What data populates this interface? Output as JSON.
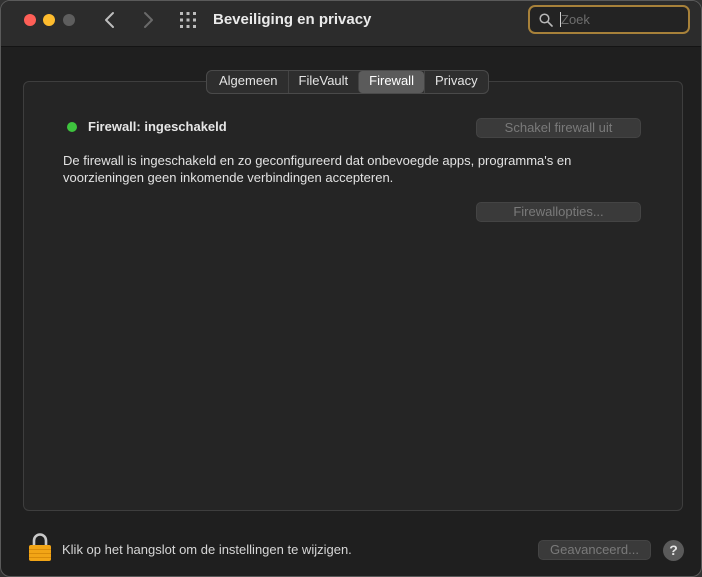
{
  "window": {
    "title": "Beveiliging en privacy"
  },
  "toolbar": {
    "back_icon": "chevron-left-icon",
    "forward_icon": "chevron-right-icon",
    "grid_icon": "grid-icon"
  },
  "search": {
    "placeholder": "Zoek",
    "value": "",
    "border_color": "#a7813a"
  },
  "tabs": [
    {
      "label": "Algemeen",
      "active": false
    },
    {
      "label": "FileVault",
      "active": false
    },
    {
      "label": "Firewall",
      "active": true
    },
    {
      "label": "Privacy",
      "active": false
    }
  ],
  "firewall": {
    "status_label": "Firewall: ingeschakeld",
    "status_color": "#3ec43e",
    "disable_button": "Schakel firewall uit",
    "description": "De firewall is ingeschakeld en zo geconfigureerd dat onbevoegde apps, programma's en voorzieningen geen inkomende verbindingen accepteren.",
    "options_button": "Firewallopties..."
  },
  "footer": {
    "lock_text": "Klik op het hangslot om de instellingen te wijzigen.",
    "advanced_button": "Geavanceerd...",
    "help_label": "?"
  }
}
